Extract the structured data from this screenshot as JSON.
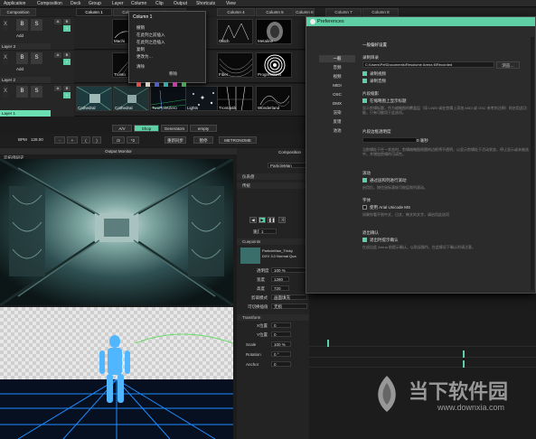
{
  "menu": [
    "Application",
    "Composition",
    "Deck",
    "Group",
    "Layer",
    "Column",
    "Clip",
    "Output",
    "Shortcuts",
    "View"
  ],
  "columns": [
    {
      "label": "Composition",
      "selected": false
    },
    {
      "label": "Column 1",
      "selected": true
    },
    {
      "label": "Column 2",
      "selected": false
    },
    {
      "label": "Column 3",
      "selected": false
    },
    {
      "label": "Column 4",
      "selected": false
    },
    {
      "label": "Column 5",
      "selected": false
    },
    {
      "label": "Column 6",
      "selected": false
    },
    {
      "label": "Column 7",
      "selected": false
    },
    {
      "label": "Column 8",
      "selected": false
    }
  ],
  "layers": [
    {
      "name": "Layer 3",
      "add": "Add",
      "active": false,
      "clips": [
        "Machi",
        "",
        "Glitch",
        "Metaline"
      ]
    },
    {
      "name": "Layer 2",
      "add": "Add",
      "active": false,
      "clips": [
        "Tronto",
        "",
        "Fiber",
        "Progressions"
      ]
    },
    {
      "name": "Layer 1",
      "add": "",
      "active": true,
      "clips": [
        "Cathedral",
        "Cathedral",
        "TwoPointZero",
        "Lights",
        "Trontastik",
        "Wonderland"
      ]
    }
  ],
  "layer_buttons": {
    "b": "B",
    "s": "S",
    "x": "X",
    "y": "Y",
    "a": "A"
  },
  "context_menu": {
    "title": "Column 1",
    "items": [
      "撤销",
      "在此列之前插入",
      "在此列之后插入",
      "复制",
      "更改为…",
      "清除",
      "移除"
    ],
    "swatches": [
      "#d94f4f",
      "#d6d0c3",
      "#4f5fc2",
      "#3ba7a7",
      "#c23fa8",
      "#4aa45a"
    ]
  },
  "toolbar": {
    "bpm_label": "BPM",
    "bpm_value": "128.00",
    "buttons": [
      "-",
      "+",
      "(",
      ")",
      "/2",
      "*2",
      "重新同步",
      "暂停"
    ],
    "tabs": [
      "A/V",
      "Shop",
      "Generators",
      "empty"
    ],
    "active_tab": "Shop",
    "metronome": "METRONOME"
  },
  "output_monitor": {
    "title": "Output Monitor",
    "preview_label": "迄拓佛研史"
  },
  "composition_panel": {
    "header": "Composition",
    "clip_name": "ParticleMan",
    "rows": [
      "仪表盘",
      "传统"
    ],
    "speed_label": "速度",
    "speed_value": "1",
    "cuepoints_label": "Cuepoints",
    "clip_info": [
      "ParticleMan_Tricky",
      "DXV 3.0 Normal Qua"
    ],
    "props": [
      {
        "label": "透明度",
        "value": "100 %"
      },
      {
        "label": "宽度",
        "value": "1280"
      },
      {
        "label": "高度",
        "value": "720"
      },
      {
        "label": "剪裁模式",
        "value": "画面填充"
      },
      {
        "label": "可切换插值",
        "value": "无损"
      }
    ],
    "transform_label": "Transform",
    "transform_props": [
      {
        "label": "X位置",
        "value": "0"
      },
      {
        "label": "Y位置",
        "value": "0"
      },
      {
        "label": "Scale",
        "value": "100 %"
      },
      {
        "label": "Rotation",
        "value": "0 °"
      },
      {
        "label": "Anchor",
        "value": "0"
      }
    ]
  },
  "preferences": {
    "title": "Preferences",
    "nav": [
      "一般",
      "音频",
      "视频",
      "MIDI",
      "OSC",
      "DMX",
      "渲染",
      "反馈",
      "池池"
    ],
    "selected_nav": "一般",
    "section_title": "一般偏好设置",
    "record_label": "录制目录",
    "record_path": "C:\\Users\\Pei\\Documents\\Resolume Arena 6\\Recorded",
    "browse": "浏览…",
    "record_checks": [
      "录制视频",
      "录制音频"
    ],
    "thumbnail_title": "片段缩影",
    "thumbnail_check": "在缩略图上显示标题",
    "thumbnail_hint": "显示剪辑标题，作为缩略图的覆盖层（如 LINEI 或在剪辑上添加 MIDI 或 OSC 参考的注释）时启用此功能，只有可能用于此选项。",
    "slider_title": "片段边框透明度",
    "slider_value": "0 毫秒",
    "slider_hint": "当剪辑处于任一状态时，剪辑缩略图周围的边框将不透明，以显示剪辑处于活动状态，停止显示或未被选中，并增加剪辑的可读性。",
    "scroll_title": "滚动",
    "scroll_check": "通过层和列进行滚动",
    "scroll_hint": "启用后，按住鼠标滚轮可按层和列滚动。",
    "font_title": "字体",
    "font_check": "使用 Arial Unicode MS",
    "font_hint": "如果你看不到中文、日文、韩文的文字，请启用此选项",
    "exit_title": "退出确认",
    "exit_check": "退出时提示确认",
    "exit_hint": "在退出此 Arena 前提示确认，以防误操作，在此情况下确认时请注意。"
  },
  "watermark": {
    "brand": "当下软件园",
    "url": "www.downxia.com"
  }
}
